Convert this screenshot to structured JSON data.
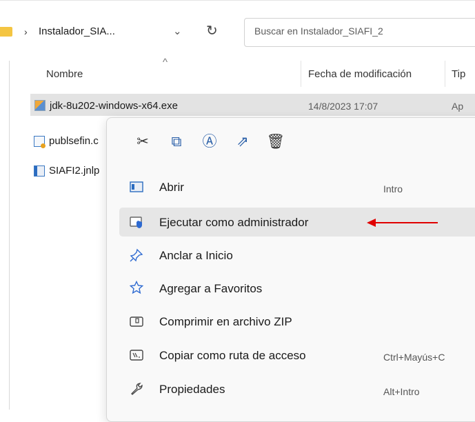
{
  "addressbar": {
    "separator": "›",
    "crumb": "Instalador_SIA...",
    "chevron": "⌄",
    "refresh": "↻",
    "search_placeholder": "Buscar en Instalador_SIAFI_2"
  },
  "columns": {
    "sort_indicator": "^",
    "name": "Nombre",
    "date": "Fecha de modificación",
    "type": "Tip"
  },
  "files": [
    {
      "name": "jdk-8u202-windows-x64.exe",
      "date": "14/8/2023 17:07",
      "type": "Ap"
    },
    {
      "name": "publsefin.c"
    },
    {
      "name": "SIAFI2.jnlp"
    }
  ],
  "context_menu": {
    "quick_actions": [
      {
        "icon": "cut-icon",
        "glyph": "✂"
      },
      {
        "icon": "copy-icon",
        "glyph": "⧉"
      },
      {
        "icon": "rename-icon",
        "glyph": "Ⓐ"
      },
      {
        "icon": "share-icon",
        "glyph": "⇗"
      },
      {
        "icon": "delete-icon",
        "glyph": "🗑"
      }
    ],
    "items": [
      {
        "label": "Abrir",
        "shortcut": "Intro",
        "icon": "open-icon"
      },
      {
        "label": "Ejecutar como administrador",
        "shortcut": "",
        "icon": "shield-icon"
      },
      {
        "label": "Anclar a Inicio",
        "shortcut": "",
        "icon": "pin-icon"
      },
      {
        "label": "Agregar a Favoritos",
        "shortcut": "",
        "icon": "star-icon"
      },
      {
        "label": "Comprimir en archivo ZIP",
        "shortcut": "",
        "icon": "zip-icon"
      },
      {
        "label": "Copiar como ruta de acceso",
        "shortcut": "Ctrl+Mayús+C",
        "icon": "path-icon"
      },
      {
        "label": "Propiedades",
        "shortcut": "Alt+Intro",
        "icon": "wrench-icon"
      }
    ]
  },
  "colors": {
    "accent": "#2e6ad1",
    "arrow": "#e00000",
    "menu_bg": "#f9f9f9",
    "selection": "#e3e3e3"
  }
}
